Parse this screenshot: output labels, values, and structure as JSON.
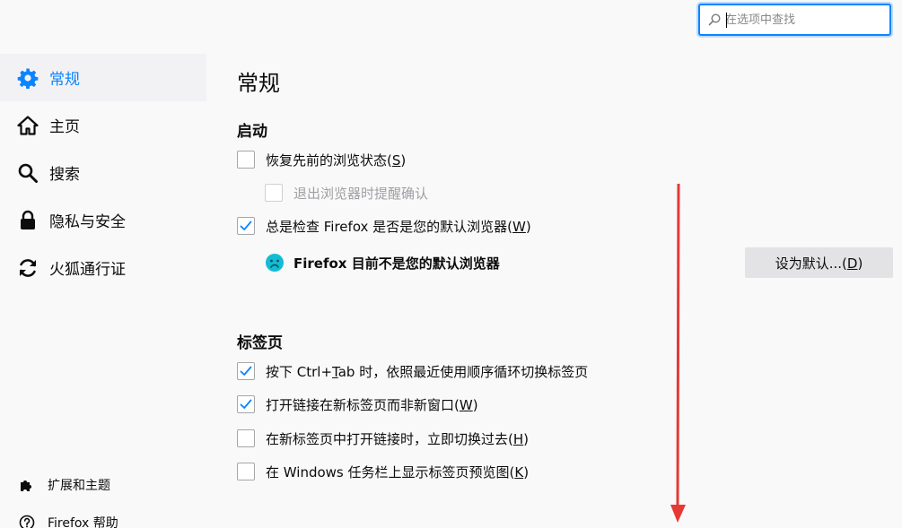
{
  "search": {
    "placeholder": "在选项中查找",
    "value": ""
  },
  "sidebar": {
    "items": [
      {
        "label": "常规",
        "icon": "gear-icon",
        "selected": true
      },
      {
        "label": "主页",
        "icon": "home-icon",
        "selected": false
      },
      {
        "label": "搜索",
        "icon": "search-icon",
        "selected": false
      },
      {
        "label": "隐私与安全",
        "icon": "lock-icon",
        "selected": false
      },
      {
        "label": "火狐通行证",
        "icon": "sync-icon",
        "selected": false
      }
    ],
    "footer": [
      {
        "label": "扩展和主题",
        "icon": "puzzle-icon"
      },
      {
        "label": "Firefox 帮助",
        "icon": "help-icon"
      }
    ]
  },
  "main": {
    "title": "常规",
    "startup": {
      "title": "启动",
      "restore_session": {
        "text": "恢复先前的浏览状态(",
        "accel": "S",
        "end": ")",
        "checked": false
      },
      "warn_on_quit": {
        "text": "退出浏览器时提醒确认",
        "checked": false,
        "disabled": true
      },
      "check_default": {
        "text": "总是检查 Firefox 是否是您的默认浏览器(",
        "accel": "W",
        "end": ")",
        "checked": true
      },
      "default_status": "Firefox 目前不是您的默认浏览器",
      "default_button": {
        "text": "设为默认...(",
        "accel": "D",
        "end": ")"
      }
    },
    "tabs": {
      "title": "标签页",
      "ctrl_tab": {
        "pre": "按下 Ctrl+",
        "accel": "T",
        "post": "ab 时，依照最近使用顺序循环切换标签页",
        "checked": true
      },
      "open_in_tab": {
        "text": "打开链接在新标签页而非新窗口(",
        "accel": "W",
        "end": ")",
        "checked": true
      },
      "switch_to_tab": {
        "text": "在新标签页中打开链接时，立即切换过去(",
        "accel": "H",
        "end": ")",
        "checked": false
      },
      "taskbar_preview": {
        "text": "在 Windows 任务栏上显示标签页预览图(",
        "accel": "K",
        "end": ")",
        "checked": false
      }
    }
  },
  "colors": {
    "accent": "#0a84ff",
    "background": "#f9f9fa",
    "annotation_arrow": "#e53935"
  }
}
